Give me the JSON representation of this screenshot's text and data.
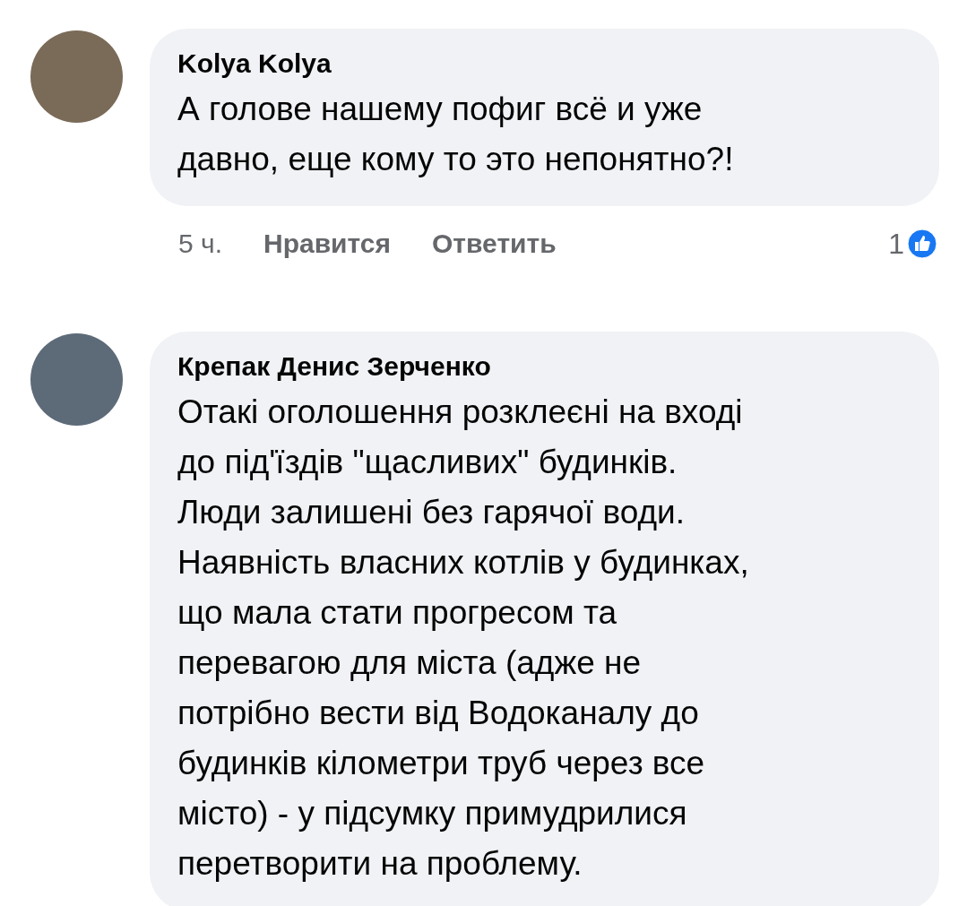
{
  "comments": [
    {
      "author": "Kolya Kolya",
      "text": "А голове нашему пофиг всё и уже\nдавно, еще кому то это непонятно?!",
      "meta": {
        "time": "5 ч.",
        "like": "Нравится",
        "reply": "Ответить",
        "reaction_count": "1"
      }
    },
    {
      "author": "Крепак Денис Зерченко",
      "text": "Отакі оголошення розклеєні на вході\nдо під'їздів \"щасливих\" будинків.\nЛюди залишені без гарячої води.\nНаявність власних котлів у будинках,\nщо мала стати прогресом та\nперевагою для міста (адже не\nпотрібно вести від Водоканалу до\nбудинків кілометри труб через все\nмісто) - у підсумку примудрилися\nперетворити на проблему."
    }
  ]
}
